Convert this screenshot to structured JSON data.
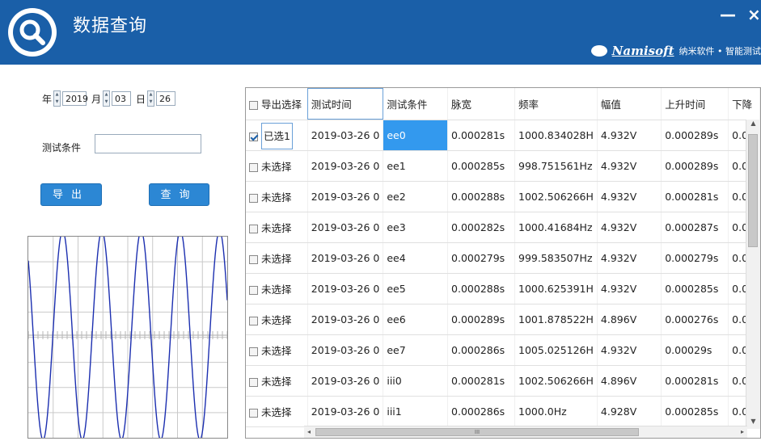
{
  "header": {
    "title": "数据查询",
    "icon": "search-icon",
    "minimize": "—",
    "close": "×",
    "brand_name": "Namisoft",
    "brand_sub": "纳米软件 • 智能测试"
  },
  "filters": {
    "year_label": "年",
    "year": "2019",
    "month_label": "月",
    "month": "03",
    "day_label": "日",
    "day": "26",
    "condition_label": "测试条件",
    "condition_value": ""
  },
  "buttons": {
    "export": "导出",
    "query": "查询"
  },
  "table": {
    "columns": [
      "导出选择",
      "测试时间",
      "测试条件",
      "脉宽",
      "频率",
      "幅值",
      "上升时间",
      "下降"
    ],
    "rows": [
      {
        "checked": true,
        "sel": "已选1",
        "time": "2019-03-26 0",
        "cond": "ee0",
        "pw": "0.000281s",
        "freq": "1000.834028H",
        "amp": "4.932V",
        "rise": "0.000289s",
        "fall": "0.0"
      },
      {
        "checked": false,
        "sel": "未选择",
        "time": "2019-03-26 0",
        "cond": "ee1",
        "pw": "0.000285s",
        "freq": "998.751561Hz",
        "amp": "4.932V",
        "rise": "0.000289s",
        "fall": "0.0"
      },
      {
        "checked": false,
        "sel": "未选择",
        "time": "2019-03-26 0",
        "cond": "ee2",
        "pw": "0.000288s",
        "freq": "1002.506266H",
        "amp": "4.932V",
        "rise": "0.000281s",
        "fall": "0.0"
      },
      {
        "checked": false,
        "sel": "未选择",
        "time": "2019-03-26 0",
        "cond": "ee3",
        "pw": "0.000282s",
        "freq": "1000.41684Hz",
        "amp": "4.932V",
        "rise": "0.000287s",
        "fall": "0.0"
      },
      {
        "checked": false,
        "sel": "未选择",
        "time": "2019-03-26 0",
        "cond": "ee4",
        "pw": "0.000279s",
        "freq": "999.583507Hz",
        "amp": "4.932V",
        "rise": "0.000279s",
        "fall": "0.0"
      },
      {
        "checked": false,
        "sel": "未选择",
        "time": "2019-03-26 0",
        "cond": "ee5",
        "pw": "0.000288s",
        "freq": "1000.625391H",
        "amp": "4.932V",
        "rise": "0.000285s",
        "fall": "0.0"
      },
      {
        "checked": false,
        "sel": "未选择",
        "time": "2019-03-26 0",
        "cond": "ee6",
        "pw": "0.000289s",
        "freq": "1001.878522H",
        "amp": "4.896V",
        "rise": "0.000276s",
        "fall": "0.0"
      },
      {
        "checked": false,
        "sel": "未选择",
        "time": "2019-03-26 0",
        "cond": "ee7",
        "pw": "0.000286s",
        "freq": "1005.025126H",
        "amp": "4.932V",
        "rise": "0.00029s",
        "fall": "0.0"
      },
      {
        "checked": false,
        "sel": "未选择",
        "time": "2019-03-26 0",
        "cond": "iii0",
        "pw": "0.000281s",
        "freq": "1002.506266H",
        "amp": "4.896V",
        "rise": "0.000281s",
        "fall": "0.0"
      },
      {
        "checked": false,
        "sel": "未选择",
        "time": "2019-03-26 0",
        "cond": "iii1",
        "pw": "0.000286s",
        "freq": "1000.0Hz",
        "amp": "4.928V",
        "rise": "0.000285s",
        "fall": "0.0"
      }
    ]
  },
  "colors": {
    "header_bg": "#1a5fa8",
    "button_bg": "#2c87d4",
    "wave": "#1c2fb0",
    "highlight": "#3399ee"
  },
  "scrollbar_glyph": "III"
}
